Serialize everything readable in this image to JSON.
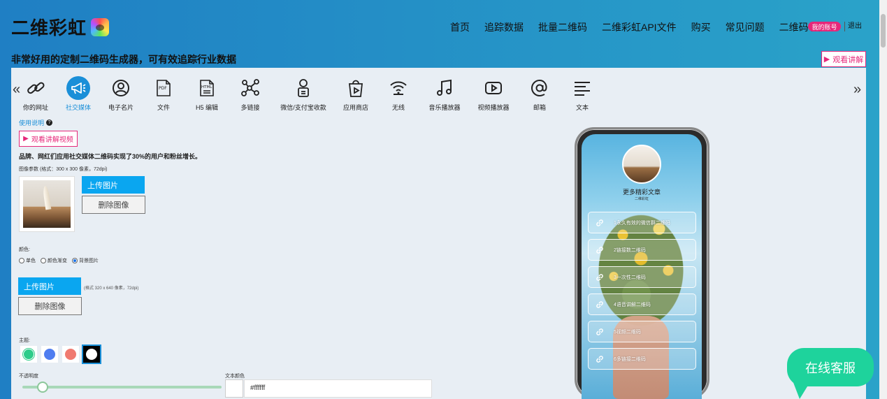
{
  "brand": {
    "name": "二维彩虹"
  },
  "nav": {
    "items": [
      "首页",
      "追踪数据",
      "批量二维码",
      "二维彩虹API文件",
      "购买",
      "常见问题",
      "二维码学院"
    ],
    "account": "我的账号",
    "logout": "退出"
  },
  "tagline": "非常好用的定制二维码生成器，可有效追踪行业数据",
  "watch_top": "观看讲解",
  "tools": [
    {
      "label": "你的网址",
      "icon": "link-icon"
    },
    {
      "label": "社交媒体",
      "icon": "megaphone-icon"
    },
    {
      "label": "电子名片",
      "icon": "user-circle-icon"
    },
    {
      "label": "文件",
      "icon": "pdf-icon"
    },
    {
      "label": "H5 编辑",
      "icon": "html-icon"
    },
    {
      "label": "多链接",
      "icon": "network-icon"
    },
    {
      "label": "微信/支付宝收款",
      "icon": "payment-icon"
    },
    {
      "label": "应用商店",
      "icon": "app-store-icon"
    },
    {
      "label": "无线",
      "icon": "wifi-icon"
    },
    {
      "label": "音乐播放器",
      "icon": "music-icon"
    },
    {
      "label": "视频播放器",
      "icon": "video-icon"
    },
    {
      "label": "邮箱",
      "icon": "email-icon"
    },
    {
      "label": "文本",
      "icon": "text-icon"
    }
  ],
  "active_tool": "社交媒体",
  "form": {
    "help_link": "使用说明",
    "watch_video": "观看讲解视频",
    "description": "品牌、网红们应用社交媒体二维码实现了30%的用户和粉丝增长。",
    "image_param": "图像参数 (格式：300 x 300 像素，72dpi)",
    "upload": "上传图片",
    "delete": "删除图像",
    "color_label": "颜色:",
    "color_options": [
      "单色",
      "颜色渐变",
      "背景图片"
    ],
    "color_selected": "背景图片",
    "bg_upload": "上传图片",
    "bg_note": "(格式 320 x 640 像素，72dpi)",
    "bg_delete": "删除图像",
    "theme_label": "主题:",
    "themes": [
      "#2ecc8a",
      "#4f7df0",
      "#f07a70",
      "#ffffff"
    ],
    "opacity_label": "不透明度",
    "opacity_value": 0.1,
    "text_color_label": "文本颜色",
    "text_color_value": "#ffffff"
  },
  "preview": {
    "title": "更多精彩文章",
    "subtitle": "二维彩虹",
    "links": [
      "1永久有效的微信群二维码",
      "2链接数二维码",
      "3一次性二维码",
      "4语音讲解二维码",
      "5视频二维码",
      "6多链接二维码"
    ]
  },
  "chat": "在线客服"
}
